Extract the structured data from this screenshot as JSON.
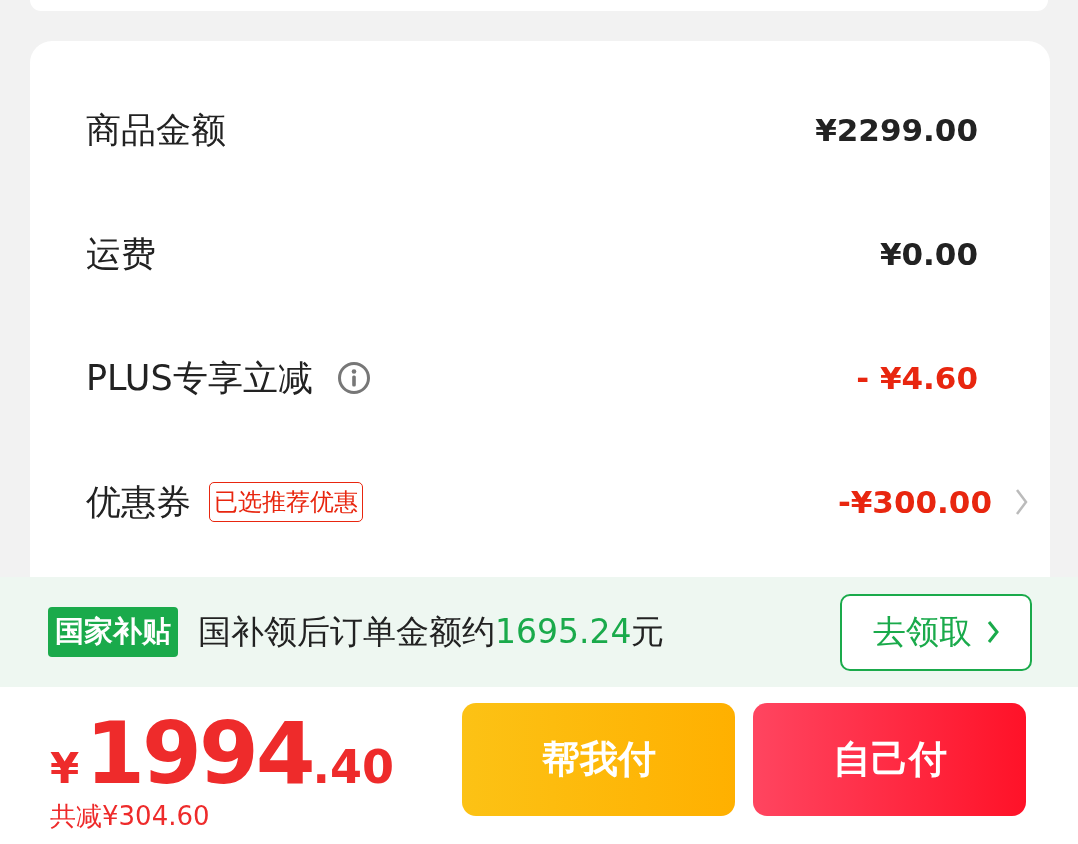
{
  "summary": {
    "rows": [
      {
        "kind": "amount",
        "label": "商品金额",
        "value": "¥2299.00"
      },
      {
        "kind": "amount",
        "label": "运费",
        "value": "¥0.00"
      },
      {
        "kind": "discount",
        "label": "PLUS专享立减",
        "value": "- ¥4.60"
      },
      {
        "kind": "coupon",
        "label": "优惠券",
        "tag": "已选推荐优惠",
        "value": "-¥300.00"
      }
    ]
  },
  "subsidy": {
    "badge": "国家补贴",
    "text": "国补领后订单金额约",
    "amount": "1695.24",
    "unit": "元",
    "button": "去领取"
  },
  "footer": {
    "currency": "¥",
    "price_int": "1994",
    "price_dec": ".40",
    "saved": "共减¥304.60",
    "buttons": [
      {
        "kind": "help",
        "label": "帮我付"
      },
      {
        "kind": "self",
        "label": "自己付"
      }
    ]
  }
}
